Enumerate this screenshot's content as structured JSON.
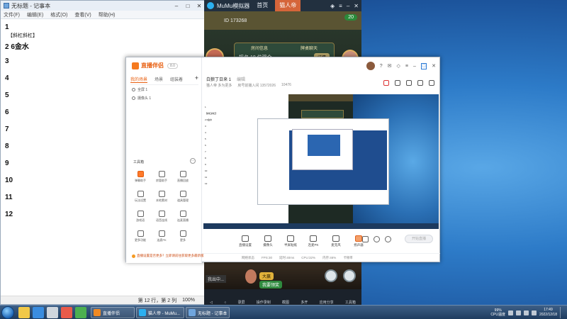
{
  "notepad": {
    "title": "无标题 - 记事本",
    "menu": [
      "文件(F)",
      "编辑(E)",
      "格式(O)",
      "查看(V)",
      "帮助(H)"
    ],
    "lines": [
      {
        "text": "1"
      },
      {
        "text": "【斜杠斜杠】",
        "small": true
      },
      {
        "text": "2 6金水"
      },
      {
        "text": "3"
      },
      {
        "text": "4"
      },
      {
        "text": "5"
      },
      {
        "text": "6"
      },
      {
        "text": "7"
      },
      {
        "text": "8"
      },
      {
        "text": "9"
      },
      {
        "text": "10"
      },
      {
        "text": "11"
      },
      {
        "text": "12"
      }
    ],
    "status_position": "第 12 行，第 2 列",
    "status_zoom": "100%"
  },
  "mumu": {
    "title": "MuMu模拟器",
    "tabs": [
      "首页",
      "猫人帝"
    ],
    "game": {
      "header_id": "ID 173268",
      "chip": "20",
      "panel_tabs": [
        "房间信息",
        "牌桌聊天"
      ],
      "panel_text": "报名 18 位观众",
      "panel_button": "详情",
      "left_label": "我出中...",
      "chip_big": "大赢",
      "chip_small": "我要领奖"
    },
    "footer": [
      "录屏",
      "操作录制",
      "截图",
      "多开",
      "应用分享",
      "工具箱"
    ]
  },
  "streamer": {
    "brand": "直播伴侣",
    "version": "8.0",
    "scene_tabs": [
      "我的场景",
      "场景",
      "组装着"
    ],
    "sources": [
      "全屏 1",
      "摄像头 1"
    ],
    "tools_title": "工具箱",
    "tools": [
      {
        "label": "弹幕助手",
        "accent": true
      },
      {
        "label": "房管助手"
      },
      {
        "label": "直播回放"
      },
      {
        "label": "玩法设置"
      },
      {
        "label": "本地素材"
      },
      {
        "label": "道具管理"
      },
      {
        "label": "游戏语"
      },
      {
        "label": "语音连线"
      },
      {
        "label": "连麦直播"
      },
      {
        "label": "更多功能"
      },
      {
        "label": "连麦PK"
      },
      {
        "label": "更多"
      }
    ],
    "warning": "直播设置是否更多？立即请前往获取更多最新版",
    "room_title": "白狼丁日来 1",
    "room_subtitle": "编辑",
    "room_meta": [
      "猫人帝  多为更多",
      "房号前播入间  13572026",
      "10476"
    ],
    "controls": [
      "直播设置",
      "摄像头",
      "半屏贴纸",
      "连麦PK",
      "麦克风",
      "扬声器"
    ],
    "start_label": "开始直播",
    "status": [
      "网络状态",
      "FPS:30",
      "延时:40ms",
      "CPU:32%",
      "内存:46%",
      "卡顿率"
    ]
  },
  "taskbar": {
    "tasks": [
      {
        "label": "直播伴侣",
        "color": "#f08a24"
      },
      {
        "label": "猫人帝 - MuMu...",
        "color": "#2bb0f0"
      },
      {
        "label": "无标题 - 记事本",
        "color": "#6fa5dd"
      }
    ],
    "cpu_label": "99%",
    "cpu_sub": "CPU温度",
    "time": "17:49",
    "date": "2022/12/18"
  }
}
